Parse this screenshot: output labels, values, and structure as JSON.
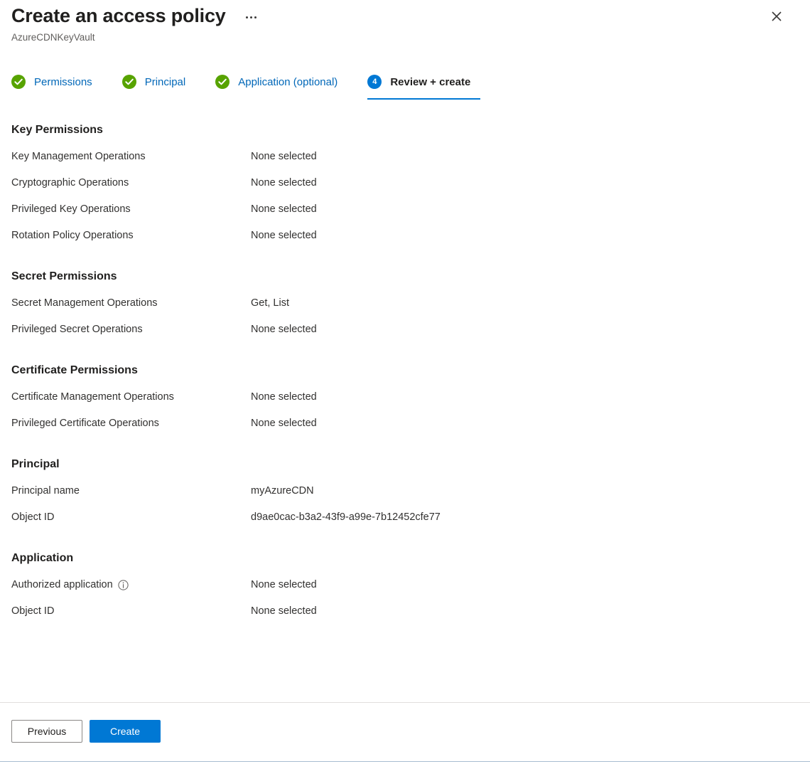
{
  "header": {
    "title": "Create an access policy",
    "subtitle": "AzureCDNKeyVault",
    "more_icon": "ellipsis-icon",
    "close_icon": "close-icon"
  },
  "tabs": [
    {
      "label": "Permissions",
      "state": "done",
      "badge": "✓"
    },
    {
      "label": "Principal",
      "state": "done",
      "badge": "✓"
    },
    {
      "label": "Application (optional)",
      "state": "done",
      "badge": "✓"
    },
    {
      "label": "Review + create",
      "state": "active",
      "badge": "4"
    }
  ],
  "sections": [
    {
      "title": "Key Permissions",
      "rows": [
        {
          "label": "Key Management Operations",
          "value": "None selected"
        },
        {
          "label": "Cryptographic Operations",
          "value": "None selected"
        },
        {
          "label": "Privileged Key Operations",
          "value": "None selected"
        },
        {
          "label": "Rotation Policy Operations",
          "value": "None selected"
        }
      ]
    },
    {
      "title": "Secret Permissions",
      "rows": [
        {
          "label": "Secret Management Operations",
          "value": "Get, List"
        },
        {
          "label": "Privileged Secret Operations",
          "value": "None selected"
        }
      ]
    },
    {
      "title": "Certificate Permissions",
      "rows": [
        {
          "label": "Certificate Management Operations",
          "value": "None selected"
        },
        {
          "label": "Privileged Certificate Operations",
          "value": "None selected"
        }
      ]
    },
    {
      "title": "Principal",
      "rows": [
        {
          "label": "Principal name",
          "value": "myAzureCDN"
        },
        {
          "label": "Object ID",
          "value": "d9ae0cac-b3a2-43f9-a99e-7b12452cfe77"
        }
      ]
    },
    {
      "title": "Application",
      "rows": [
        {
          "label": "Authorized application",
          "value": "None selected",
          "info_icon": "info-icon"
        },
        {
          "label": "Object ID",
          "value": "None selected"
        }
      ]
    }
  ],
  "footer": {
    "previous_label": "Previous",
    "create_label": "Create"
  },
  "colors": {
    "accent": "#0078d4",
    "tab_link": "#0067b8",
    "success": "#57a300",
    "text": "#323130",
    "muted": "#605e5c"
  }
}
